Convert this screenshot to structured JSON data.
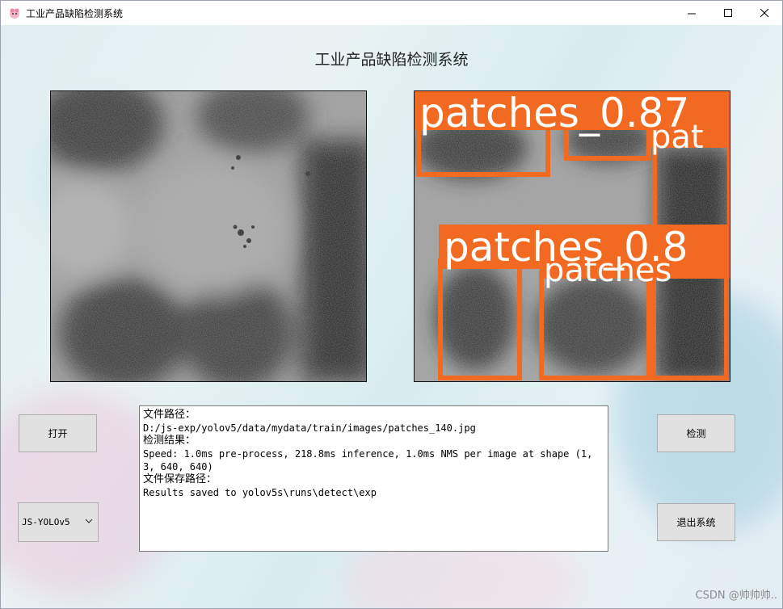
{
  "window": {
    "title": "工业产品缺陷检测系统",
    "controls": {
      "minimize": "—",
      "maximize": "☐",
      "close": "✕"
    }
  },
  "heading": "工业产品缺陷检测系统",
  "images": {
    "input_icon": "grayscale-defect-image",
    "output_icon": "detection-result-image",
    "detections": [
      {
        "label": "patches_0.87"
      },
      {
        "label": "patches_0.8"
      },
      {
        "label": "patches"
      },
      {
        "label": "pat"
      }
    ],
    "box_color": "#f26a21"
  },
  "buttons": {
    "open": "打开",
    "detect": "检测",
    "exit": "退出系统"
  },
  "model_select": {
    "value": "JS-YOLOv5"
  },
  "output": {
    "path_label": "文件路径：",
    "path_value": "D:/js-exp/yolov5/data/mydata/train/images/patches_140.jpg",
    "result_label": "检测结果：",
    "result_value": "Speed: 1.0ms pre-process, 218.8ms inference, 1.0ms NMS per image at shape (1, 3, 640, 640)",
    "save_label": "文件保存路径：",
    "save_value": "Results saved to yolov5s\\runs\\detect\\exp"
  },
  "watermark": "CSDN @帅帅帅.."
}
